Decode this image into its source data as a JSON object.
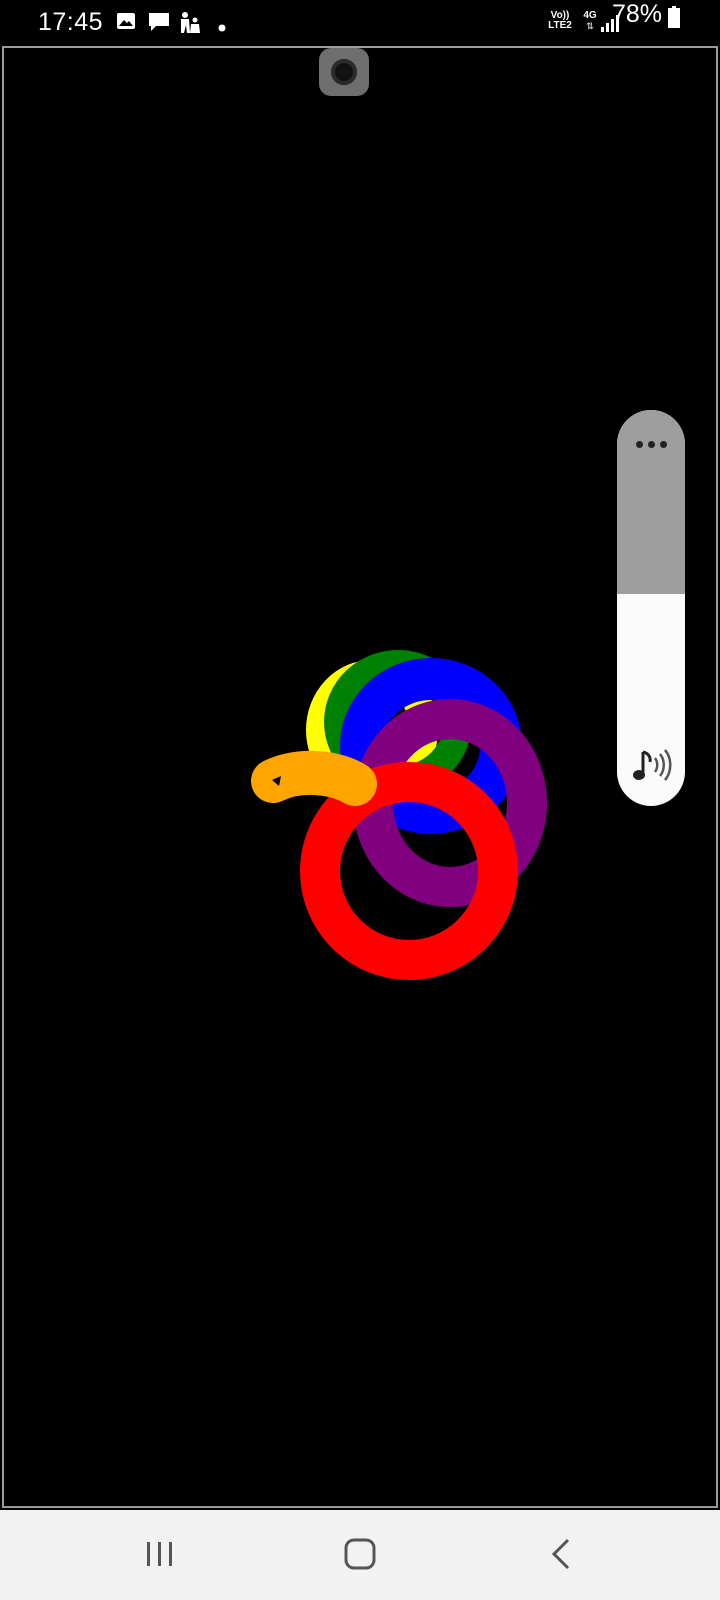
{
  "status_bar": {
    "time": "17:45",
    "left_icons": [
      "gallery-icon",
      "message-icon",
      "app-icon",
      "dot-icon"
    ],
    "volte_label_top": "Vo))",
    "volte_label_bottom": "LTE2",
    "network_type": "4G",
    "battery_percent": "78%",
    "signal_icon": "signal-icon",
    "battery_icon": "battery-icon"
  },
  "canvas": {
    "background": "#000000",
    "stroke_colors": {
      "yellow": "#ffff00",
      "green": "#008000",
      "blue": "#0000ff",
      "purple": "#800080",
      "red": "#ff0000",
      "orange": "#ffa500"
    }
  },
  "volume_panel": {
    "more_icon": "more-options-icon",
    "media_icon": "media-volume-icon",
    "level": 0.54
  },
  "nav_bar": {
    "recent_icon": "recent-apps-icon",
    "home_icon": "home-icon",
    "back_icon": "back-icon"
  }
}
